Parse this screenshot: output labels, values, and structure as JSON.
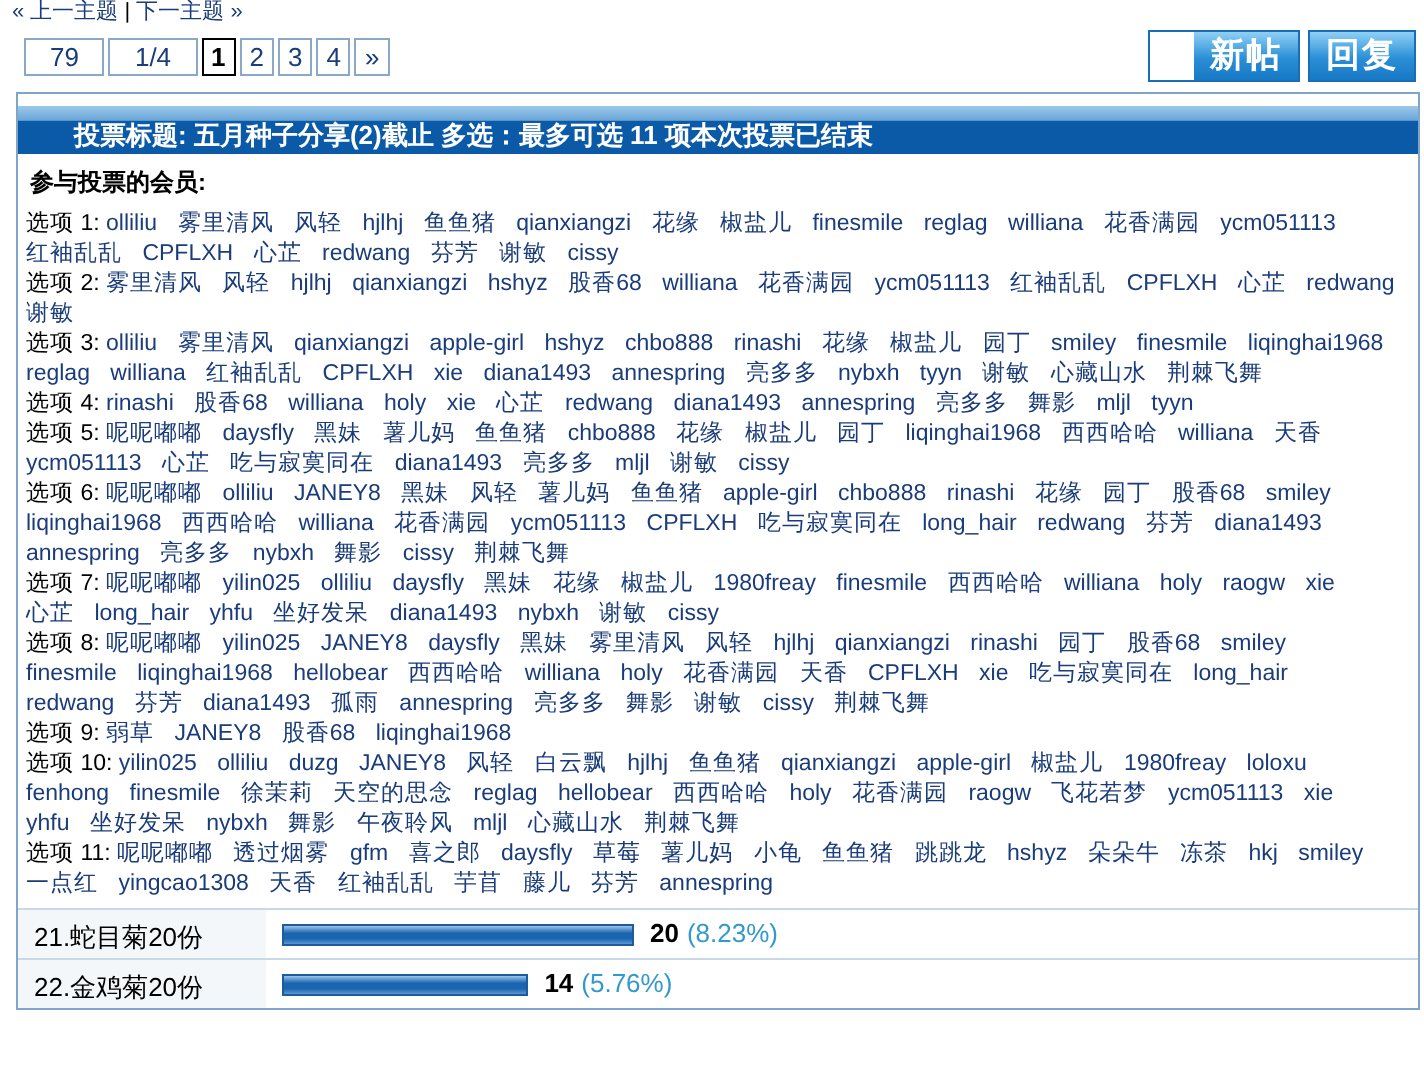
{
  "nav": {
    "prev": "« 上一主题",
    "separator": "|",
    "next": "下一主题 »"
  },
  "pager": {
    "total": "79",
    "position": "1/4",
    "pages": [
      {
        "label": "1",
        "selected": true
      },
      {
        "label": "2",
        "selected": false
      },
      {
        "label": "3",
        "selected": false
      },
      {
        "label": "4",
        "selected": false
      }
    ],
    "next": "»"
  },
  "buttons": [
    {
      "label": "新帖",
      "kind": "new"
    },
    {
      "label": "回复",
      "kind": "reply"
    }
  ],
  "poll": {
    "title": "投票标题: 五月种子分享(2)截止  多选：最多可选 11 项本次投票已结束",
    "voters_heading": "参与投票的会员:",
    "options": [
      {
        "label": "选项 1:",
        "members": [
          "olliliu",
          "雾里清风",
          "风轻",
          "hjlhj",
          "鱼鱼猪",
          "qianxiangzi",
          "花缘",
          "椒盐儿",
          "finesmile",
          "reglag",
          "williana",
          "花香满园",
          "ycm051113",
          "红袖乱乱",
          "CPFLXH",
          "心芷",
          "redwang",
          "芬芳",
          "谢敏",
          "cissy"
        ]
      },
      {
        "label": "选项 2:",
        "members": [
          "雾里清风",
          "风轻",
          "hjlhj",
          "qianxiangzi",
          "hshyz",
          "股香68",
          "williana",
          "花香满园",
          "ycm051113",
          "红袖乱乱",
          "CPFLXH",
          "心芷",
          "redwang",
          "谢敏"
        ]
      },
      {
        "label": "选项 3:",
        "members": [
          "olliliu",
          "雾里清风",
          "qianxiangzi",
          "apple-girl",
          "hshyz",
          "chbo888",
          "rinashi",
          "花缘",
          "椒盐儿",
          "园丁",
          "smiley",
          "finesmile",
          "liqinghai1968",
          "reglag",
          "williana",
          "红袖乱乱",
          "CPFLXH",
          "xie",
          "diana1493",
          "annespring",
          "亮多多",
          "nybxh",
          "tyyn",
          "谢敏",
          "心藏山水",
          "荆棘飞舞"
        ]
      },
      {
        "label": "选项 4:",
        "members": [
          "rinashi",
          "股香68",
          "williana",
          "holy",
          "xie",
          "心芷",
          "redwang",
          "diana1493",
          "annespring",
          "亮多多",
          "舞影",
          "mljl",
          "tyyn"
        ]
      },
      {
        "label": "选项 5:",
        "members": [
          "呢呢嘟嘟",
          "daysfly",
          "黑妹",
          "薯儿妈",
          "鱼鱼猪",
          "chbo888",
          "花缘",
          "椒盐儿",
          "园丁",
          "liqinghai1968",
          "西西哈哈",
          "williana",
          "天香",
          "ycm051113",
          "心芷",
          "吃与寂寞同在",
          "diana1493",
          "亮多多",
          "mljl",
          "谢敏",
          "cissy"
        ]
      },
      {
        "label": "选项 6:",
        "members": [
          "呢呢嘟嘟",
          "olliliu",
          "JANEY8",
          "黑妹",
          "风轻",
          "薯儿妈",
          "鱼鱼猪",
          "apple-girl",
          "chbo888",
          "rinashi",
          "花缘",
          "园丁",
          "股香68",
          "smiley",
          "liqinghai1968",
          "西西哈哈",
          "williana",
          "花香满园",
          "ycm051113",
          "CPFLXH",
          "吃与寂寞同在",
          "long_hair",
          "redwang",
          "芬芳",
          "diana1493",
          "annespring",
          "亮多多",
          "nybxh",
          "舞影",
          "cissy",
          "荆棘飞舞"
        ]
      },
      {
        "label": "选项 7:",
        "members": [
          "呢呢嘟嘟",
          "yilin025",
          "olliliu",
          "daysfly",
          "黑妹",
          "花缘",
          "椒盐儿",
          "1980freay",
          "finesmile",
          "西西哈哈",
          "williana",
          "holy",
          "raogw",
          "xie",
          "心芷",
          "long_hair",
          "yhfu",
          "坐好发呆",
          "diana1493",
          "nybxh",
          "谢敏",
          "cissy"
        ]
      },
      {
        "label": "选项 8:",
        "members": [
          "呢呢嘟嘟",
          "yilin025",
          "JANEY8",
          "daysfly",
          "黑妹",
          "雾里清风",
          "风轻",
          "hjlhj",
          "qianxiangzi",
          "rinashi",
          "园丁",
          "股香68",
          "smiley",
          "finesmile",
          "liqinghai1968",
          "hellobear",
          "西西哈哈",
          "williana",
          "holy",
          "花香满园",
          "天香",
          "CPFLXH",
          "xie",
          "吃与寂寞同在",
          "long_hair",
          "redwang",
          "芬芳",
          "diana1493",
          "孤雨",
          "annespring",
          "亮多多",
          "舞影",
          "谢敏",
          "cissy",
          "荆棘飞舞"
        ]
      },
      {
        "label": "选项 9:",
        "members": [
          "弱草",
          "JANEY8",
          "股香68",
          "liqinghai1968"
        ]
      },
      {
        "label": "选项 10:",
        "members": [
          "yilin025",
          "olliliu",
          "duzg",
          "JANEY8",
          "风轻",
          "白云飘",
          "hjlhj",
          "鱼鱼猪",
          "qianxiangzi",
          "apple-girl",
          "椒盐儿",
          "1980freay",
          "loloxu",
          "fenhong",
          "finesmile",
          "徐茉莉",
          "天空的思念",
          "reglag",
          "hellobear",
          "西西哈哈",
          "holy",
          "花香满园",
          "raogw",
          "飞花若梦",
          "ycm051113",
          "xie",
          "yhfu",
          "坐好发呆",
          "nybxh",
          "舞影",
          "午夜聆风",
          "mljl",
          "心藏山水",
          "荆棘飞舞"
        ]
      },
      {
        "label": "选项 11:",
        "members": [
          "呢呢嘟嘟",
          "透过烟雾",
          "gfm",
          "喜之郎",
          "daysfly",
          "草莓",
          "薯儿妈",
          "小龟",
          "鱼鱼猪",
          "跳跳龙",
          "hshyz",
          "朵朵牛",
          "冻茶",
          "hkj",
          "smiley",
          "一点红",
          "yingcao1308",
          "天香",
          "红袖乱乱",
          "芋苜",
          "藤儿",
          "芬芳",
          "annespring"
        ]
      }
    ],
    "results": [
      {
        "label": "21.蛇目菊20份",
        "count": "20",
        "percent": "(8.23%)"
      },
      {
        "label": "22.金鸡菊20份",
        "count": "14",
        "percent": "(5.76%)"
      }
    ]
  }
}
